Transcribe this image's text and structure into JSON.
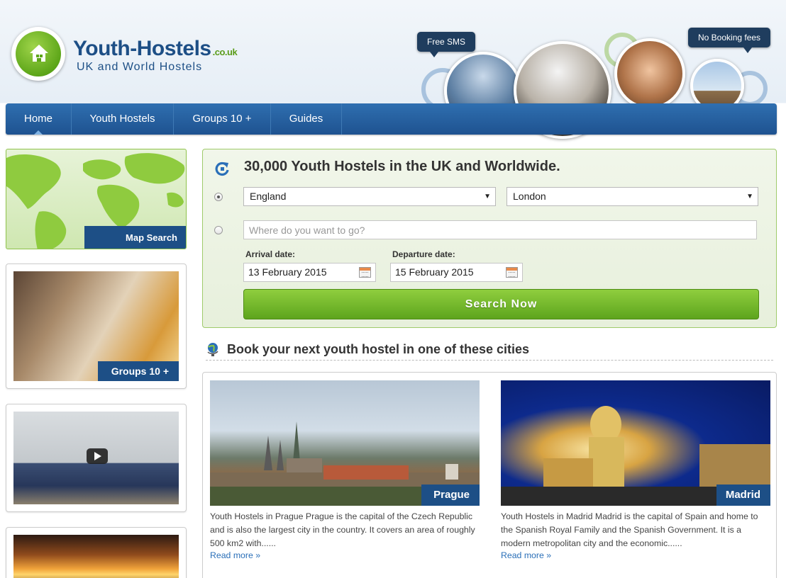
{
  "header": {
    "brand_name": "Youth-Hostels",
    "brand_tld": ".co.uk",
    "tagline": "UK and World Hostels",
    "bubble_sms": "Free SMS",
    "bubble_fees": "No Booking fees"
  },
  "nav": {
    "items": [
      {
        "label": "Home",
        "active": true
      },
      {
        "label": "Youth Hostels"
      },
      {
        "label": "Groups 10 +"
      },
      {
        "label": "Guides"
      }
    ]
  },
  "sidebar": {
    "map_label": "Map Search",
    "groups_label": "Groups 10 +"
  },
  "search": {
    "title": "30,000 Youth Hostels in the UK and Worldwide.",
    "country": "England",
    "city": "London",
    "destination_placeholder": "Where do you want to go?",
    "arrival_label": "Arrival date:",
    "arrival_value": "13 February 2015",
    "departure_label": "Departure date:",
    "departure_value": "15 February 2015",
    "button_label": "Search Now",
    "radio_selected": "country_city"
  },
  "cities": {
    "heading": "Book your next youth hostel in one of these cities",
    "items": [
      {
        "name": "Prague",
        "text": "Youth Hostels in Prague Prague is the capital of the Czech Republic and  is also the largest city in the country.  It covers an area of roughly 500 km2 with......",
        "link": "Read more »"
      },
      {
        "name": "Madrid",
        "text": "Youth Hostels in Madrid Madrid is the capital of Spain and home to the Spanish Royal Family and the Spanish Government.  It is a modern metropolitan city and the economic......",
        "link": "Read more »"
      }
    ]
  },
  "colors": {
    "brand_blue": "#1d4f86",
    "nav_blue": "#2a64a6",
    "accent_green": "#6ab42b",
    "link_blue": "#2a6fb8"
  }
}
